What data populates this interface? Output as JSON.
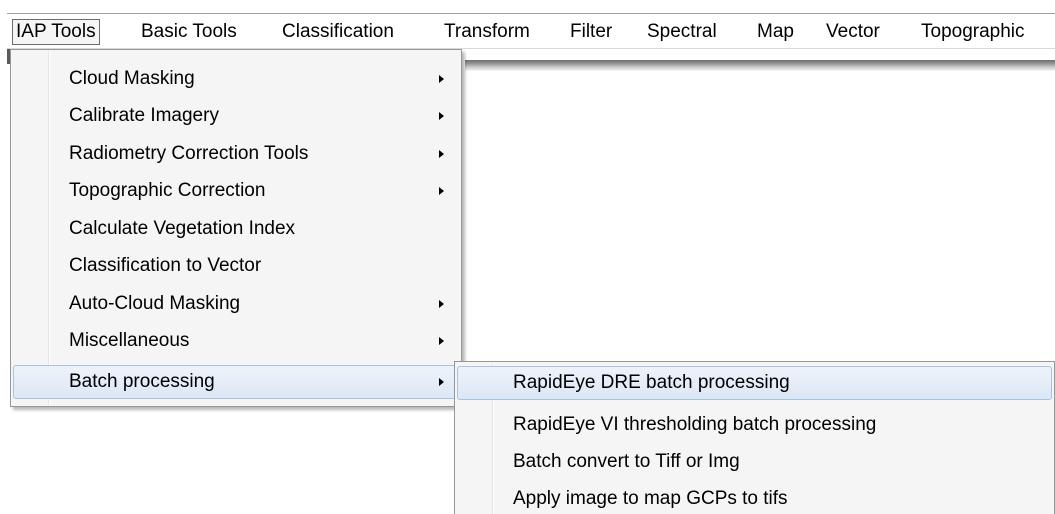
{
  "menubar": {
    "items": [
      {
        "label": "IAP Tools",
        "active": true
      },
      {
        "label": "Basic Tools"
      },
      {
        "label": "Classification"
      },
      {
        "label": "Transform"
      },
      {
        "label": "Filter"
      },
      {
        "label": "Spectral"
      },
      {
        "label": "Map"
      },
      {
        "label": "Vector"
      },
      {
        "label": "Topographic"
      }
    ]
  },
  "iap_menu": {
    "items": [
      {
        "label": "Cloud Masking",
        "has_submenu": true
      },
      {
        "label": "Calibrate Imagery",
        "has_submenu": true
      },
      {
        "label": "Radiometry Correction Tools",
        "has_submenu": true
      },
      {
        "label": "Topographic Correction",
        "has_submenu": true
      },
      {
        "label": "Calculate Vegetation Index",
        "has_submenu": false
      },
      {
        "label": "Classification to Vector",
        "has_submenu": false
      },
      {
        "label": "Auto-Cloud Masking",
        "has_submenu": true
      },
      {
        "label": "Miscellaneous",
        "has_submenu": true
      },
      {
        "label": "Batch processing",
        "has_submenu": true,
        "highlighted": true
      }
    ]
  },
  "batch_menu": {
    "items": [
      {
        "label": "RapidEye DRE batch processing",
        "highlighted": true
      },
      {
        "label": "RapidEye VI thresholding batch processing"
      },
      {
        "label": "Batch convert to Tiff or Img"
      },
      {
        "label": "Apply image to map GCPs to tifs"
      }
    ]
  },
  "colors": {
    "menu_background": "#f5f5f5",
    "highlight_fill": "#dce7f5",
    "highlight_border": "#a8c2e3",
    "active_border": "#6d6d6d"
  }
}
